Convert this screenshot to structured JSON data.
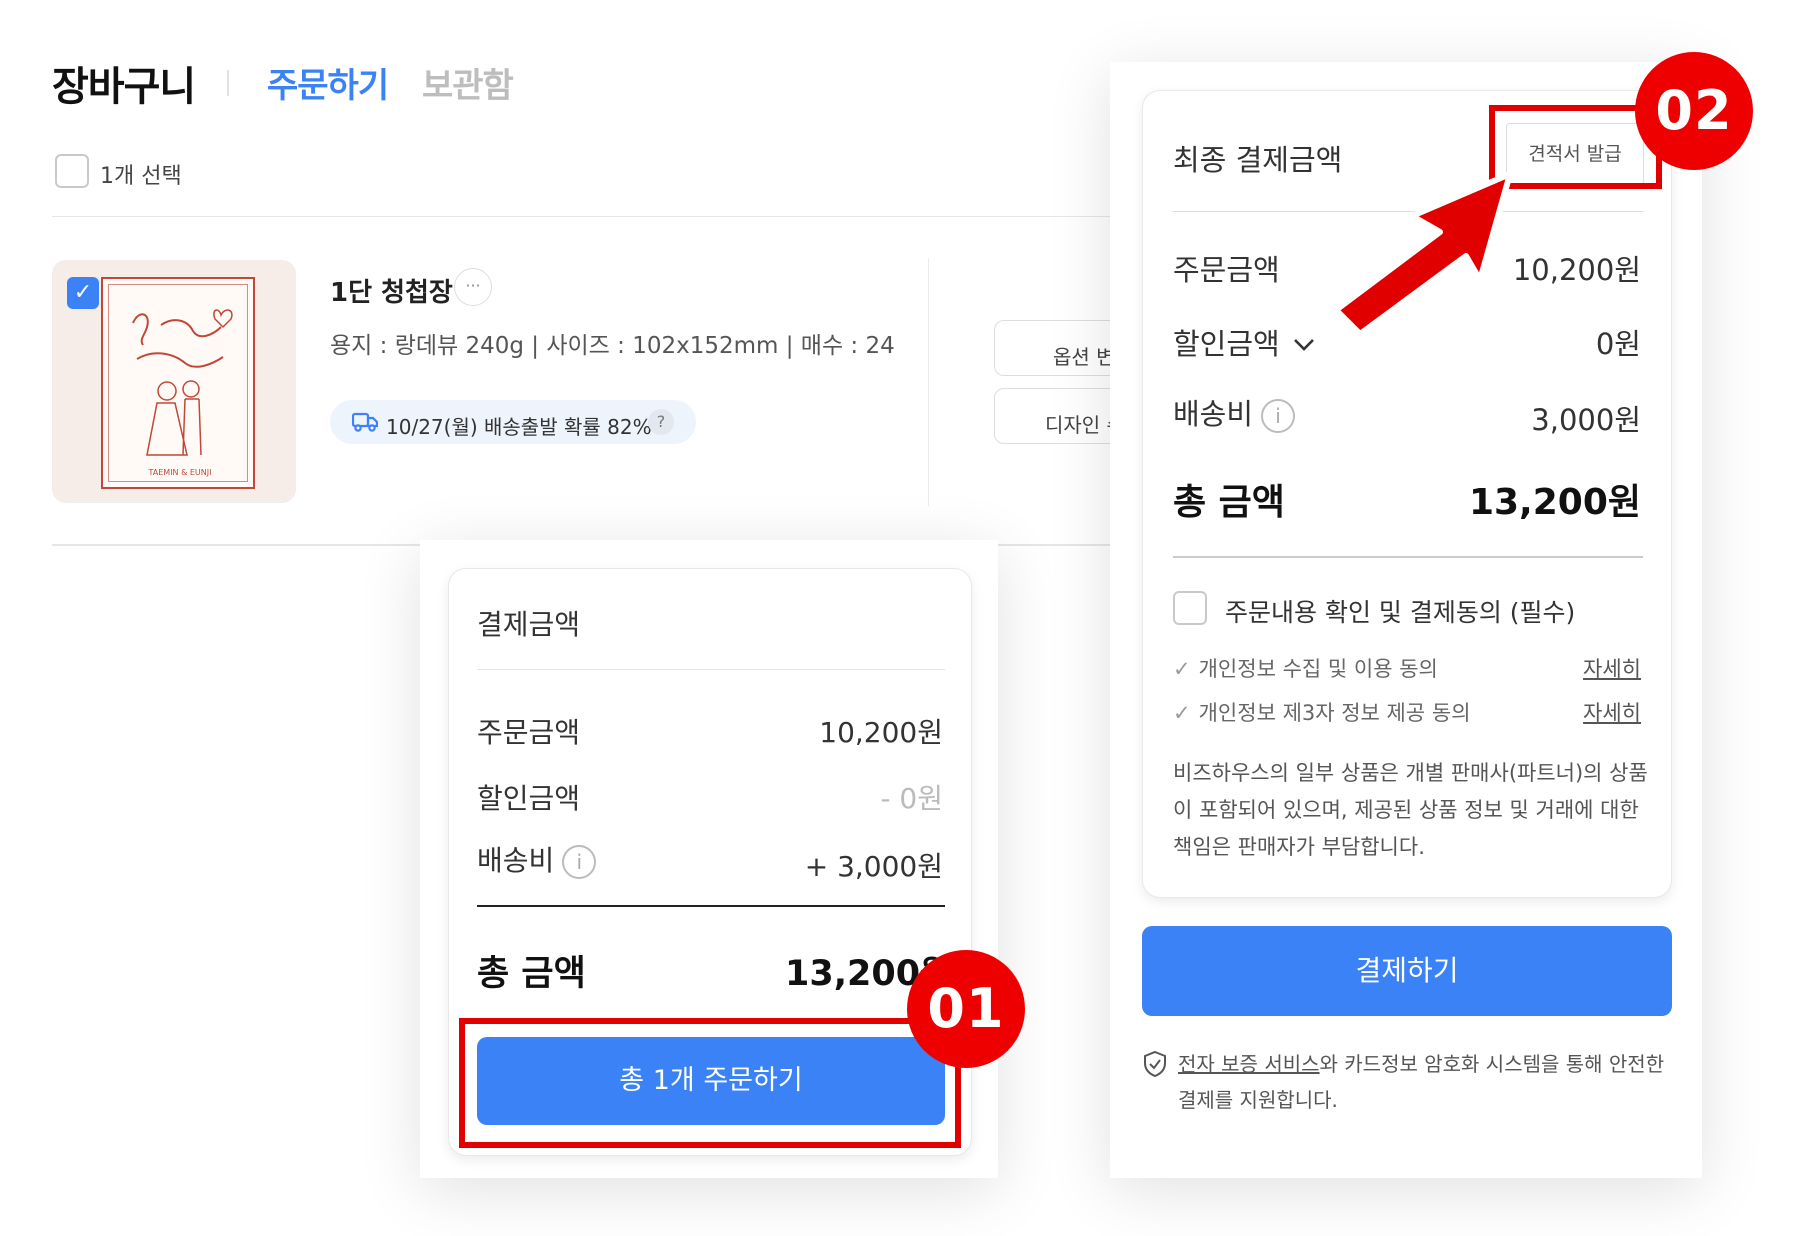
{
  "header": {
    "title": "장바구니",
    "tabs": [
      {
        "label": "주문하기",
        "active": true
      },
      {
        "label": "보관함",
        "active": false
      }
    ]
  },
  "selection": {
    "label": "1개 선택"
  },
  "item": {
    "name": "1단 청첩장",
    "more_label": "···",
    "options": "용지 : 랑데뷰 240g | 사이즈 : 102x152mm | 매수 : 24",
    "shipping": "10/27(월) 배송출발 확률 82%",
    "shipping_help": "?",
    "buttons": {
      "option_change": "옵션 변",
      "design": "디자인 수"
    },
    "selected": true
  },
  "payment_simple": {
    "title": "결제금액",
    "rows": [
      {
        "label": "주문금액",
        "value": "10,200원"
      },
      {
        "label": "할인금액",
        "value": "- 0원"
      },
      {
        "label": "배송비",
        "value": "+ 3,000원"
      }
    ],
    "total_label": "총 금액",
    "total_value": "13,200원",
    "button": "총 1개 주문하기",
    "badge": "01"
  },
  "payment_final": {
    "title": "최종 결제금액",
    "quote_button": "견적서 발급",
    "rows": [
      {
        "label": "주문금액",
        "value": "10,200원"
      },
      {
        "label": "할인금액",
        "value": "0원"
      },
      {
        "label": "배송비",
        "value": "3,000원"
      }
    ],
    "total_label": "총 금액",
    "total_value": "13,200원",
    "agree_label": "주문내용 확인 및 결제동의 (필수)",
    "sub_agreements": [
      {
        "label": "개인정보 수집 및 이용 동의",
        "link": "자세히"
      },
      {
        "label": "개인정보 제3자 정보 제공 동의",
        "link": "자세히"
      }
    ],
    "notice": "비즈하우스의 일부 상품은 개별 판매사(파트너)의 상품이 포함되어 있으며, 제공된 상품 정보 및 거래에 대한 책임은 판매자가 부담합니다.",
    "pay_button": "결제하기",
    "secure_link": "전자 보증 서비스",
    "secure_text": "와 카드정보 암호화 시스템을 통해 안전한 결제를 지원합니다.",
    "badge": "02"
  },
  "colors": {
    "accent": "#3b82f6",
    "highlight": "#e00000",
    "muted": "#bdbdbd"
  },
  "icons": [
    "check-icon",
    "truck-icon",
    "help-icon",
    "info-icon",
    "chevron-down-icon",
    "shield-check-icon",
    "arrow-icon"
  ]
}
